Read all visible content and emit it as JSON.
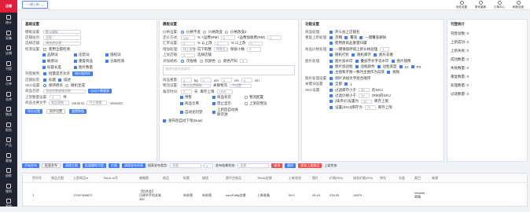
{
  "sidebar": {
    "logo": "店铺",
    "items": [
      "统计",
      "采集",
      "店铺",
      "刊登",
      "订单",
      "仓库",
      "物流",
      "财务",
      "产品",
      "客服",
      "退款",
      "规则",
      "营销"
    ]
  },
  "topbar": {
    "tab": "一键上新",
    "close": "×",
    "right": [
      "软件设置",
      "联系客服",
      "订单中心",
      "刷新页面"
    ]
  },
  "p1": {
    "title": "基础设置",
    "rows": [
      {
        "label": "模板设置:",
        "value": "默认模板"
      },
      {
        "label": "店铺站点:",
        "value": "全部"
      },
      {
        "label": "选择店铺:",
        "value": "请选择店铺"
      }
    ],
    "checks_title": "检测设置:",
    "checks_sub": "使用全部检测",
    "checks": [
      "品牌词",
      "违禁词",
      "侵权词",
      "敏感词",
      "重复商品",
      "分类检测",
      "标题长度",
      "图片数量"
    ],
    "filter": "刊登顺序:",
    "filter_btn": "按价格排序",
    "filter_mode": "批量是否允许",
    "tags_title": "店铺标签:",
    "tags": [
      "标题",
      "描述"
    ],
    "sku": "SKU设置:",
    "sku_a": "保持原有",
    "sku_b": "随机生成",
    "pack": "商品包装:",
    "pack_v": "添加包装规格详细",
    "pack_btn": "自动计算重量",
    "upc": "上架数量设置:",
    "upc_v": "1",
    "upc_unit": "件",
    "fields": [
      "商品主要文字",
      "商品规格",
      "Variant1",
      "尺寸规格",
      "Variant2"
    ],
    "btns": [
      "保存设置",
      "同步设置",
      "重置数据"
    ]
  },
  "p2": {
    "title": "模板设置",
    "price_title": "价格设置:",
    "price_opts": [
      "价格不变",
      "价格改变",
      "价格改变2"
    ],
    "rows": [
      {
        "label": "定价方式:",
        "a": "100",
        "b": "% +运费(RM)",
        "c": "0",
        "d": "+运费加收费(RM)",
        "e": "2"
      },
      {
        "label": "汇率设置:",
        "a": "0",
        "b": "% 以上改",
        "c": "0",
        "d": "% 以上改",
        "e": "0"
      },
      {
        "label": "增加处理:",
        "a": "向上取整",
        "b": "向下取整",
        "c": "四舍五入",
        "d": "保留小数",
        "e": "2"
      },
      {
        "label": "上架店铺:",
        "a": "1",
        "b": "选择店铺"
      }
    ],
    "attr_title": "添加规格:",
    "attr": [
      "仅规格",
      "仅颜色",
      "颜色尺码"
    ],
    "attr_n": "1",
    "desc_ph": "描述内容在此填写",
    "weight_title": "商品重量:",
    "weight": [
      "0",
      "kg",
      "0",
      "cm",
      "0",
      "cm",
      "0",
      "cm"
    ],
    "ship_title": "物流设置:",
    "ship_v": "默认运费模板",
    "ship_v2": "关联物流",
    "ship_v3": "不设置",
    "time_title": "备货时间:",
    "time_v": "3",
    "time_unit": "天",
    "time_t": "库存上限",
    "time_max": "1000",
    "opts": [
      "预售",
      "商品有货",
      "物流配置",
      "商品仓库",
      "禁止显示",
      "上架前预览",
      "自动化刊登",
      "上新后自动关联货源"
    ],
    "extra": "发布后自动下架(Now)"
  },
  "p3": {
    "title": "功能设置",
    "rows": [
      {
        "label": "商品处理:",
        "opts": [
          "开头加上店铺名"
        ]
      },
      {
        "label": "重复上新处理:",
        "opts": [
          "忽略",
          "覆盖",
          "一键覆盖删除"
        ]
      },
      {
        "label": "",
        "opts": [
          "使用原商品重量归属"
        ]
      },
      {
        "label": "商品价格处理:",
        "opts": [
          "一键保留原链上新价格处理"
        ],
        "v": "1"
      },
      {
        "label": "",
        "opts": [
          "随机打折",
          "随机库存",
          "图片去重"
        ]
      },
      {
        "label": "图片处理:",
        "opts": [
          "图片加水印",
          "叠加字文字去水印",
          "图片镜像"
        ]
      },
      {
        "label": "",
        "opts": [
          "图片加边框",
          "边框颜色",
          "边框宽度",
          "10",
          "PX"
        ]
      },
      {
        "label": "",
        "opts": [
          "主图和子图一致时主图作为白底",
          "视频"
        ]
      },
      {
        "label": "图片处理设置:",
        "opts": [
          "图片添加文字组合顺序"
        ]
      },
      {
        "label": "关键词设置:",
        "opts": [
          "全部",
          "1"
        ]
      }
    ],
    "sku_title": "SKU设置:",
    "sku_rows": [
      {
        "t": "过滤库存小于",
        "v": "10",
        "u": "的SKU"
      },
      {
        "t": "过滤价格小于",
        "v": "10",
        "u": "(RM)的SKU"
      },
      {
        "t": "(排序价)设置为",
        "v": "10",
        "u": "库存上限"
      },
      {
        "t": "设置(SKU)库存为",
        "v": "10",
        "u": "库存上限"
      }
    ]
  },
  "p4": {
    "title": "刊登统计",
    "rows": [
      "刊登总数: 0",
      "上新成功: 0",
      "上新失败: 0",
      "成功数量: 0",
      "失败数量: 0",
      "重复数量: 0",
      "处理数量: 0",
      "过滤数量: 0"
    ]
  },
  "actionbar": {
    "btns": [
      "开始发布",
      "批量发布",
      "清理主图",
      "批量删除刊登",
      "价格",
      "清理发布列表"
    ],
    "select_label": "搜索发布类型:",
    "select_v": "全部",
    "page": "1",
    "search_label": "发布结果状态:",
    "search_v": "全部",
    "search_btn": "查询",
    "del_btn": "删除",
    "save_btn": "保存上架商品",
    "status": "上架状态:"
  },
  "table": {
    "headers": [
      "",
      "序列号",
      "商品主图",
      "上家商品id",
      "Tiktok-id号",
      "缩略图",
      "商品",
      "标题",
      "描述",
      "源平台商品",
      "Tiktok店铺",
      "上新状态",
      "图片",
      "价格(RM)",
      "成本价格(RM)",
      "库存",
      "分类",
      "类目",
      "来源"
    ],
    "row": [
      "1",
      "",
      "17047356872",
      "",
      "【铝合金】\n可调节手机支架 360",
      "",
      "未处理",
      "未处理",
      "sourPailly店铺",
      "上新准备",
      "99.0",
      "45.15",
      "234.33",
      "14870",
      "",
      "",
      "shopee\n商城"
    ]
  }
}
